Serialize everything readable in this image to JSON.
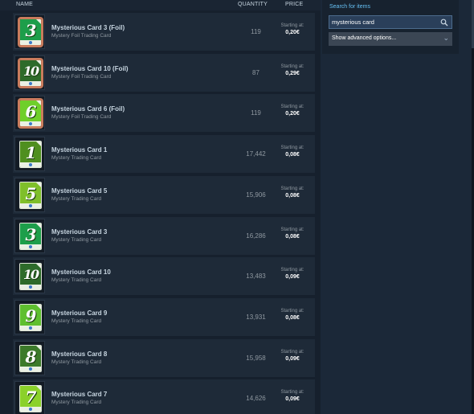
{
  "table": {
    "header": {
      "name": "NAME",
      "quantity": "QUANTITY",
      "price": "PRICE"
    },
    "rows": [
      {
        "name": "Mysterious Card 3 (Foil)",
        "game": "Mystery Foil Trading Card",
        "quantity": "119",
        "price_label": "Starting at:",
        "price": "0,20€",
        "card_number": "3",
        "card_color": "#1d9e4a",
        "foil": true
      },
      {
        "name": "Mysterious Card 10 (Foil)",
        "game": "Mystery Foil Trading Card",
        "quantity": "87",
        "price_label": "Starting at:",
        "price": "0,29€",
        "card_number": "10",
        "card_color": "#2e6b2a",
        "foil": true
      },
      {
        "name": "Mysterious Card 6 (Foil)",
        "game": "Mystery Foil Trading Card",
        "quantity": "119",
        "price_label": "Starting at:",
        "price": "0,20€",
        "card_number": "6",
        "card_color": "#6fcf2a",
        "foil": true
      },
      {
        "name": "Mysterious Card 1",
        "game": "Mystery Trading Card",
        "quantity": "17,442",
        "price_label": "Starting at:",
        "price": "0,08€",
        "card_number": "1",
        "card_color": "#4f8f1f",
        "foil": false
      },
      {
        "name": "Mysterious Card 5",
        "game": "Mystery Trading Card",
        "quantity": "15,906",
        "price_label": "Starting at:",
        "price": "0,08€",
        "card_number": "5",
        "card_color": "#7fbf2a",
        "foil": false
      },
      {
        "name": "Mysterious Card 3",
        "game": "Mystery Trading Card",
        "quantity": "16,286",
        "price_label": "Starting at:",
        "price": "0,08€",
        "card_number": "3",
        "card_color": "#1d9e4a",
        "foil": false
      },
      {
        "name": "Mysterious Card 10",
        "game": "Mystery Trading Card",
        "quantity": "13,483",
        "price_label": "Starting at:",
        "price": "0,09€",
        "card_number": "10",
        "card_color": "#2e6b2a",
        "foil": false
      },
      {
        "name": "Mysterious Card 9",
        "game": "Mystery Trading Card",
        "quantity": "13,931",
        "price_label": "Starting at:",
        "price": "0,08€",
        "card_number": "9",
        "card_color": "#5fbf2f",
        "foil": false
      },
      {
        "name": "Mysterious Card 8",
        "game": "Mystery Trading Card",
        "quantity": "15,958",
        "price_label": "Starting at:",
        "price": "0,09€",
        "card_number": "8",
        "card_color": "#3c7a2a",
        "foil": false
      },
      {
        "name": "Mysterious Card 7",
        "game": "Mystery Trading Card",
        "quantity": "14,626",
        "price_label": "Starting at:",
        "price": "0,09€",
        "card_number": "7",
        "card_color": "#8bd12a",
        "foil": false
      }
    ]
  },
  "search": {
    "label": "Search for items",
    "value": "mysterious card",
    "advanced_label": "Show advanced options...",
    "icon": "search-icon"
  },
  "colors": {
    "accent": "#66c0f4",
    "background": "#1b2838",
    "row": "#1e2a38",
    "foil_border": "#c97c5d"
  }
}
